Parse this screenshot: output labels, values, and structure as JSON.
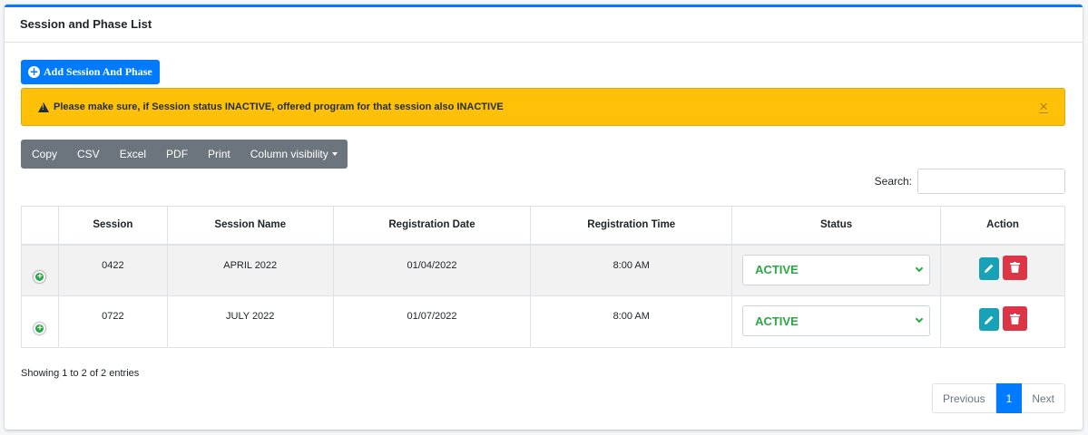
{
  "card": {
    "title": "Session and Phase List"
  },
  "add_button": {
    "label": "Add Session And Phase",
    "icon": "plus-circle-icon"
  },
  "alert": {
    "icon": "warning-triangle-icon",
    "text": "Please make sure, if Session status INACTIVE, offered program for that session also INACTIVE",
    "close": "×",
    "color": "#ffc107"
  },
  "export_buttons": [
    "Copy",
    "CSV",
    "Excel",
    "PDF",
    "Print",
    "Column visibility"
  ],
  "search": {
    "label": "Search:",
    "value": ""
  },
  "table": {
    "headers": [
      "",
      "Session",
      "Session Name",
      "Registration Date",
      "Registration Time",
      "Status",
      "Action"
    ],
    "rows": [
      {
        "session": "0422",
        "name": "APRIL 2022",
        "date": "01/04/2022",
        "time": "8:00 AM",
        "status": "ACTIVE"
      },
      {
        "session": "0722",
        "name": "JULY 2022",
        "date": "01/07/2022",
        "time": "8:00 AM",
        "status": "ACTIVE"
      }
    ]
  },
  "info": "Showing 1 to 2 of 2 entries",
  "pagination": {
    "previous": "Previous",
    "current": "1",
    "next": "Next"
  },
  "colors": {
    "primary": "#007bff",
    "success": "#28a745",
    "danger": "#dc3545",
    "info": "#17a2b8",
    "secondary": "#6c757d"
  }
}
